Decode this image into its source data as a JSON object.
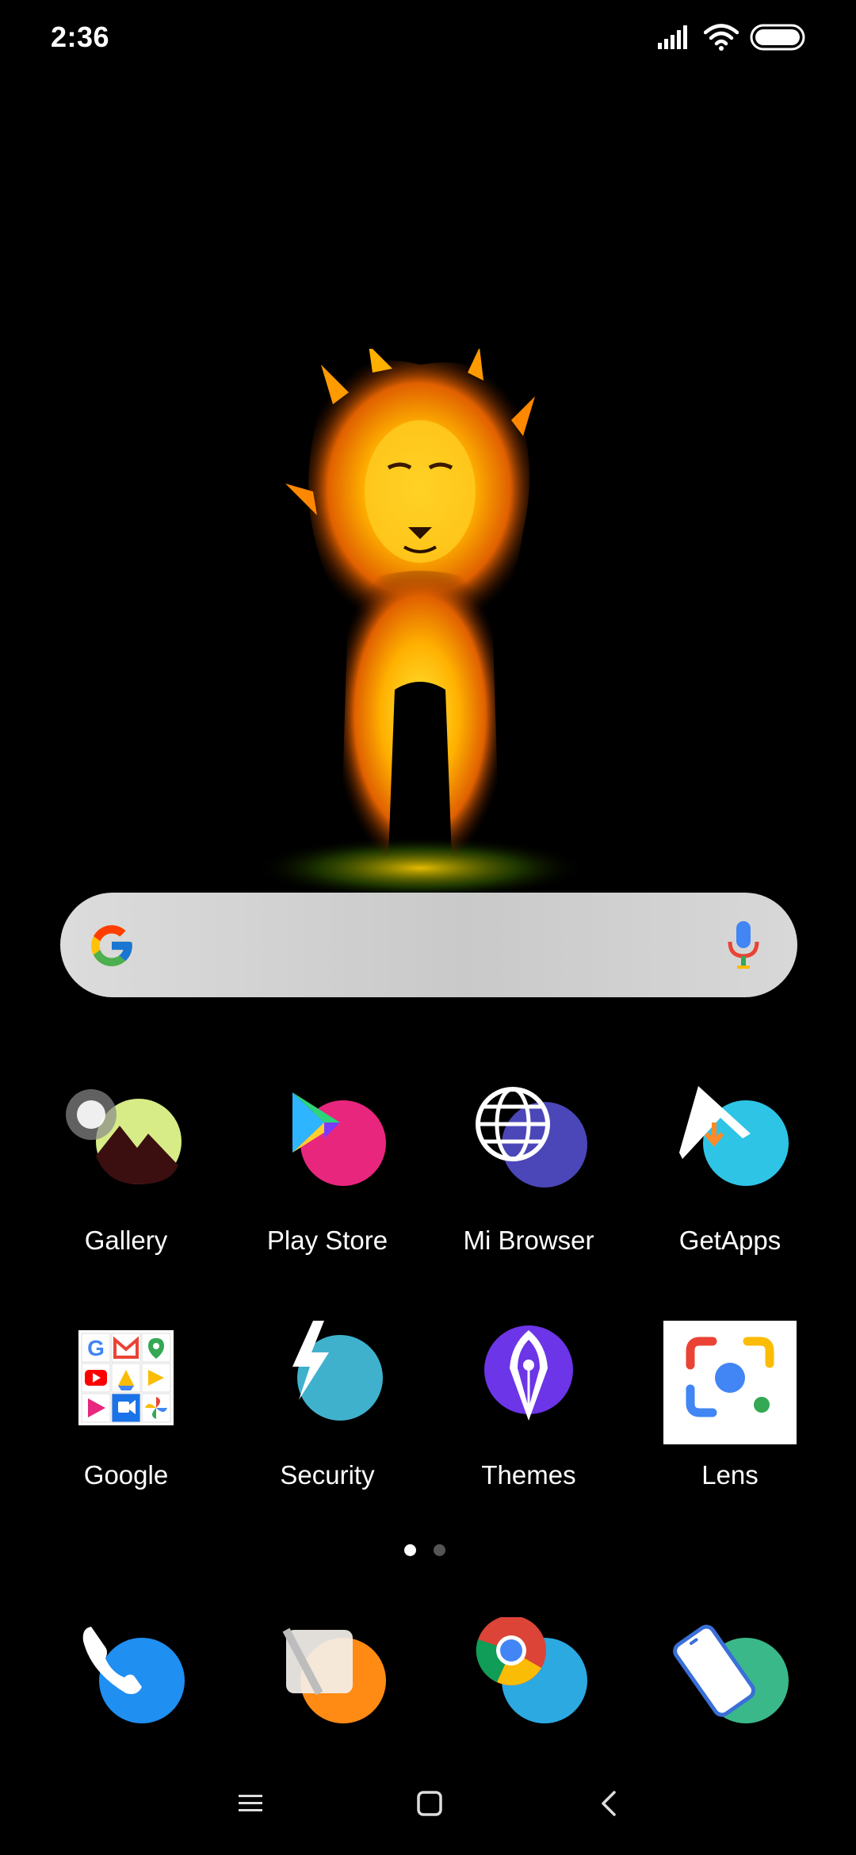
{
  "status_bar": {
    "time": "2:36",
    "icons": [
      "signal-icon",
      "wifi-icon",
      "battery-icon"
    ]
  },
  "wallpaper": {
    "subject": "fire-lion-illustration"
  },
  "search_bar": {
    "logo": "google-g-icon",
    "voice": "microphone-icon"
  },
  "apps_row1": [
    {
      "label": "Gallery",
      "icon": "gallery-icon"
    },
    {
      "label": "Play Store",
      "icon": "play-store-icon"
    },
    {
      "label": "Mi Browser",
      "icon": "globe-icon"
    },
    {
      "label": "GetApps",
      "icon": "getapps-icon"
    }
  ],
  "apps_row2": [
    {
      "label": "Google",
      "icon": "google-folder-icon"
    },
    {
      "label": "Security",
      "icon": "security-bolt-icon"
    },
    {
      "label": "Themes",
      "icon": "pen-nib-icon"
    },
    {
      "label": "Lens",
      "icon": "lens-icon"
    }
  ],
  "page_indicator": {
    "pages": 2,
    "active": 1
  },
  "dock": [
    {
      "icon": "phone-icon"
    },
    {
      "icon": "notes-icon"
    },
    {
      "icon": "chrome-icon"
    },
    {
      "icon": "device-icon"
    }
  ],
  "nav": [
    "menu-icon",
    "home-icon",
    "back-icon"
  ],
  "colors": {
    "background": "#000000",
    "search_bar": "#d4d4d4",
    "text": "#ffffff"
  }
}
